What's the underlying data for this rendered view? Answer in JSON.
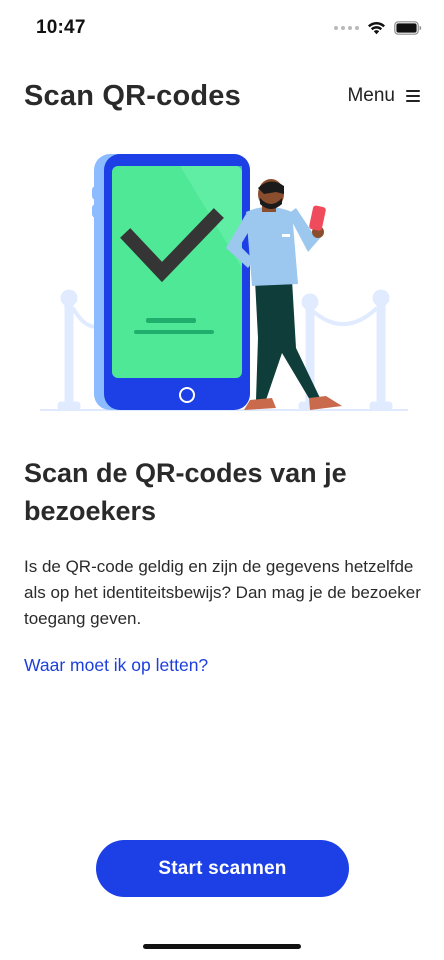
{
  "status_bar": {
    "time": "10:47"
  },
  "header": {
    "title": "Scan QR-codes",
    "menu_label": "Menu"
  },
  "illustration": {
    "icon": "phone-with-checkmark-and-person-illustration"
  },
  "content": {
    "heading": "Scan de QR-codes van je bezoekers",
    "body": "Is de QR-code geldig en zijn de gegevens hetzelfde als op het identiteitsbewijs? Dan mag je de bezoeker toegang geven.",
    "link": "Waar moet ik op letten?"
  },
  "actions": {
    "start_label": "Start scannen"
  },
  "colors": {
    "accent": "#1c3fe6",
    "link": "#1c3fdc",
    "phone_screen": "#4ee897",
    "text": "#2a2a2a"
  }
}
